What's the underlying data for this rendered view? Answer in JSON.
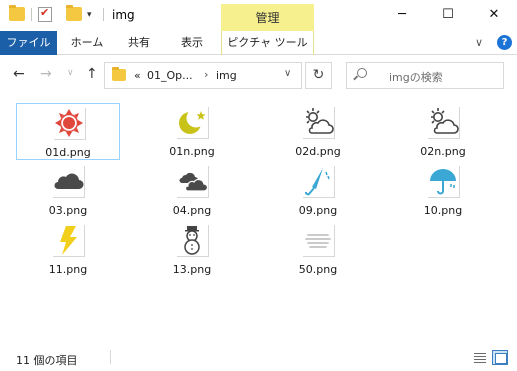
{
  "window": {
    "title": "img",
    "context_tab_header": "管理"
  },
  "ribbon": {
    "tabs": [
      "ファイル",
      "ホーム",
      "共有",
      "表示",
      "ピクチャ ツール"
    ]
  },
  "address": {
    "overflow": "«",
    "crumbs": [
      "01_Op...",
      "img"
    ]
  },
  "search": {
    "placeholder": "imgの検索"
  },
  "files": [
    {
      "name": "01d.png",
      "icon": "sun-icon"
    },
    {
      "name": "01n.png",
      "icon": "moon-star-icon"
    },
    {
      "name": "02d.png",
      "icon": "sun-cloud-icon"
    },
    {
      "name": "02n.png",
      "icon": "sun-cloud-icon"
    },
    {
      "name": "03.png",
      "icon": "cloud-icon"
    },
    {
      "name": "04.png",
      "icon": "double-cloud-icon"
    },
    {
      "name": "09.png",
      "icon": "closed-umbrella-icon"
    },
    {
      "name": "10.png",
      "icon": "umbrella-rain-icon"
    },
    {
      "name": "11.png",
      "icon": "lightning-icon"
    },
    {
      "name": "13.png",
      "icon": "snowman-icon"
    },
    {
      "name": "50.png",
      "icon": "mist-icon"
    }
  ],
  "status": {
    "count_text": "11 個の項目"
  },
  "colors": {
    "ribbon_file_tab": "#1b5fa8",
    "context_tab": "#f6f08f",
    "selection_border": "#99d1ff",
    "sun_red": "#e0473d",
    "moon_yellow": "#c9c219",
    "umbrella_blue": "#3aa7d5",
    "bolt_yellow": "#f2cf1a",
    "cloud_dark": "#4a4a4a"
  }
}
